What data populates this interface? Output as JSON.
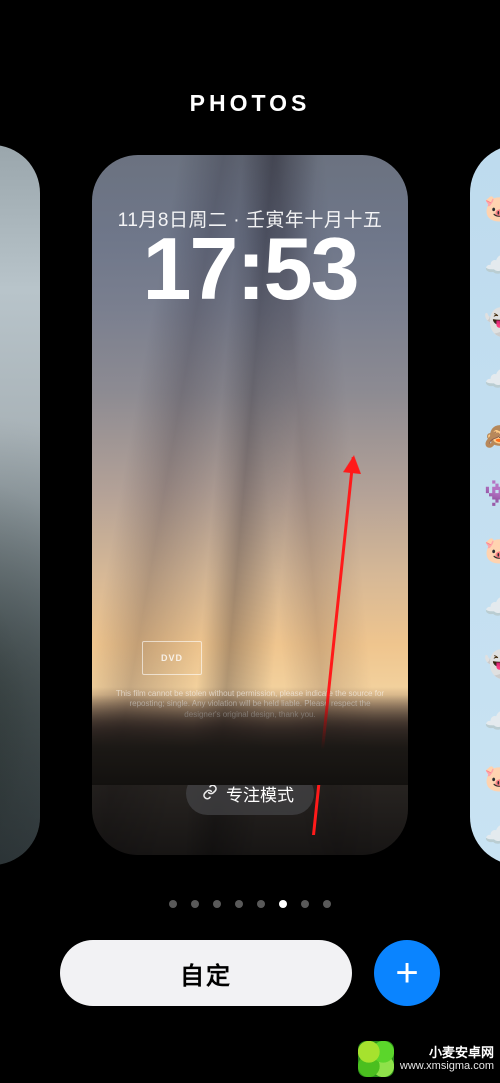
{
  "header": {
    "title": "PHOTOS"
  },
  "lockscreen": {
    "date": "11月8日周二 · 壬寅年十月十五",
    "time": "17:53",
    "logo_text": "DVD",
    "caption": "This film cannot be stolen without permission, please indicate the source for reposting; single. Any violation will be held liable. Please respect the designer's original design, thank you.",
    "focus_label": "专注模式"
  },
  "right_emojis": [
    "🐷",
    "☁️",
    "👻",
    "☁️",
    "🙈",
    "👾",
    "🐷",
    "☁️",
    "👻",
    "☁️",
    "🐷",
    "☁️"
  ],
  "pager": {
    "count": 8,
    "active_index": 5
  },
  "bottom": {
    "customize": "自定",
    "add": "+"
  },
  "watermark": {
    "line1": "小麦安卓网",
    "line2": "www.xmsigma.com"
  }
}
